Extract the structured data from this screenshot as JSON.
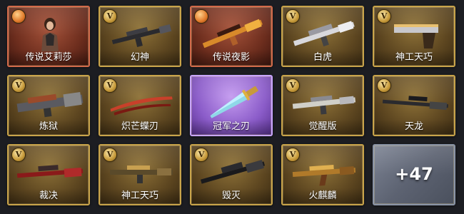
{
  "items": [
    {
      "name": "传说艾莉莎",
      "rarity": "legendary",
      "badge_icon": "legend-emblem-icon"
    },
    {
      "name": "幻神",
      "rarity": "gold",
      "badge_icon": "v-emblem-icon"
    },
    {
      "name": "传说夜影",
      "rarity": "legendary",
      "badge_icon": "legend-emblem-icon"
    },
    {
      "name": "白虎",
      "rarity": "gold",
      "badge_icon": "v-emblem-icon"
    },
    {
      "name": "神工天巧",
      "rarity": "gold",
      "badge_icon": "v-emblem-icon"
    },
    {
      "name": "炼狱",
      "rarity": "gold",
      "badge_icon": "v-emblem-icon"
    },
    {
      "name": "炽芒蝶刃",
      "rarity": "gold",
      "badge_icon": "v-emblem-icon"
    },
    {
      "name": "冠军之刃",
      "rarity": "champion",
      "badge_icon": "none"
    },
    {
      "name": "觉醒版",
      "rarity": "gold",
      "badge_icon": "v-emblem-icon"
    },
    {
      "name": "天龙",
      "rarity": "gold",
      "badge_icon": "v-emblem-icon"
    },
    {
      "name": "裁决",
      "rarity": "gold",
      "badge_icon": "v-emblem-icon"
    },
    {
      "name": "神工天巧",
      "rarity": "gold",
      "badge_icon": "v-emblem-icon"
    },
    {
      "name": "毁灭",
      "rarity": "gold",
      "badge_icon": "v-emblem-icon"
    },
    {
      "name": "火麒麟",
      "rarity": "gold",
      "badge_icon": "v-emblem-icon"
    }
  ],
  "more": {
    "label": "+47"
  },
  "badge_letter": "V",
  "colors": {
    "gold_border": "#c9a44a",
    "legendary_border": "#d26a4a",
    "champion_border": "#c9a6ff",
    "more_bg": "#5d6372"
  }
}
